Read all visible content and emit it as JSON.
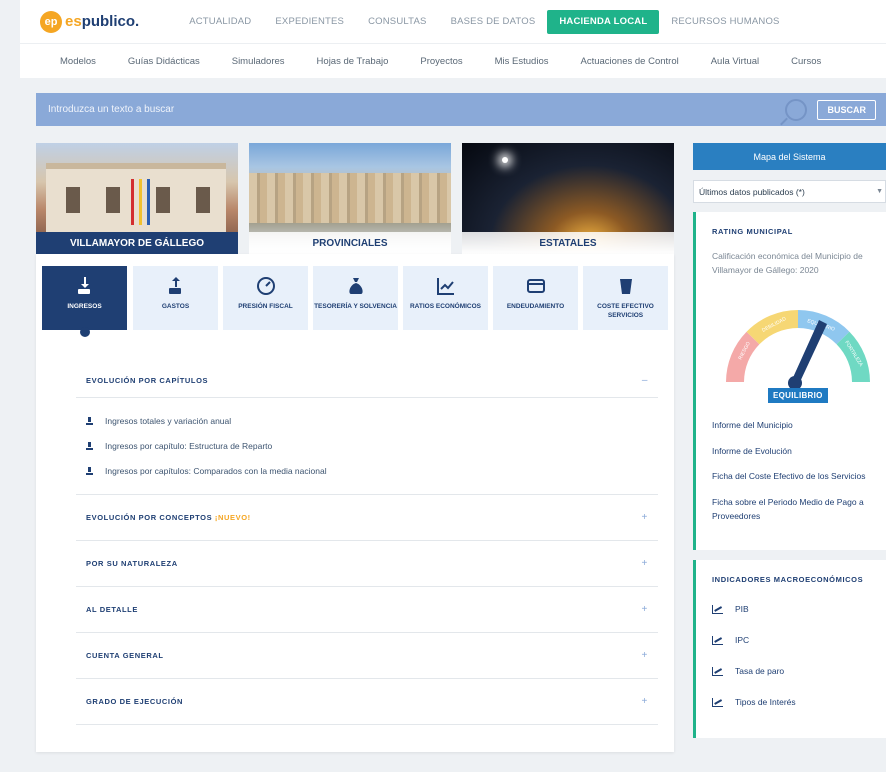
{
  "logo": {
    "mark": "ep",
    "part1": "es",
    "part2": "publico."
  },
  "main_nav": [
    "ACTUALIDAD",
    "EXPEDIENTES",
    "CONSULTAS",
    "BASES DE DATOS",
    "HACIENDA LOCAL",
    "RECURSOS HUMANOS"
  ],
  "main_nav_active": "HACIENDA LOCAL",
  "sub_nav": [
    "Modelos",
    "Guías Didácticas",
    "Simuladores",
    "Hojas de Trabajo",
    "Proyectos",
    "Mis Estudios",
    "Actuaciones de Control",
    "Aula Virtual",
    "Cursos"
  ],
  "search": {
    "placeholder": "Introduzca un texto a buscar",
    "button": "BUSCAR"
  },
  "cards": {
    "local": "VILLAMAYOR DE GÁLLEGO",
    "provincial": "PROVINCIALES",
    "state": "ESTATALES"
  },
  "tiles": [
    {
      "label": "INGRESOS",
      "icon": "download-hand-icon"
    },
    {
      "label": "GASTOS",
      "icon": "upload-hand-icon"
    },
    {
      "label": "PRESIÓN FISCAL",
      "icon": "gauge-icon"
    },
    {
      "label": "TESORERÍA Y SOLVENCIA",
      "icon": "money-bag-icon"
    },
    {
      "label": "RATIOS ECONÓMICOS",
      "icon": "line-chart-icon"
    },
    {
      "label": "ENDEUDAMIENTO",
      "icon": "credit-card-icon"
    },
    {
      "label": "COSTE EFECTIVO SERVICIOS",
      "icon": "trash-bin-icon"
    }
  ],
  "accordion": {
    "capitulos": {
      "title": "EVOLUCIÓN POR CAPÍTULOS",
      "toggle": "–"
    },
    "capitulos_links": [
      "Ingresos totales y variación anual",
      "Ingresos por capítulo: Estructura de Reparto",
      "Ingresos por capítulos: Comparados con la media nacional"
    ],
    "conceptos": {
      "title": "EVOLUCIÓN POR CONCEPTOS",
      "badge": "¡NUEVO!",
      "toggle": "+"
    },
    "naturaleza": {
      "title": "POR SU NATURALEZA",
      "toggle": "+"
    },
    "detalle": {
      "title": "AL DETALLE",
      "toggle": "+"
    },
    "cuenta": {
      "title": "CUENTA GENERAL",
      "toggle": "+"
    },
    "ejecucion": {
      "title": "GRADO DE EJECUCIÓN",
      "toggle": "+"
    }
  },
  "sidebar": {
    "sitemap_button": "Mapa del Sistema",
    "select_value": "Últimos datos publicados (*)",
    "rating": {
      "title": "RATING MUNICIPAL",
      "description": "Calificación económica del Municipio de Villamayor de Gállego: 2020",
      "gauge_segments": [
        "RIESGO",
        "DEBILIDAD",
        "EQUILIBRIO",
        "FORTALEZA"
      ],
      "gauge_colors": [
        "#f4a9a8",
        "#f6d774",
        "#8fc7ef",
        "#6fd9c3"
      ],
      "result": "EQUILIBRIO",
      "links": [
        "Informe del Municipio",
        "Informe de Evolución",
        "Ficha del Coste Efectivo de los Servicios",
        "Ficha sobre el Periodo Medio de Pago a Proveedores"
      ]
    },
    "macro": {
      "title": "INDICADORES MACROECONÓMICOS",
      "items": [
        "PIB",
        "IPC",
        "Tasa de paro",
        "Tipos de Interés"
      ]
    }
  },
  "colors": {
    "navy": "#1f3f73",
    "green": "#1fb38a",
    "blue": "#2a7fc1",
    "search": "#8aa9d8",
    "accent": "#f5a623"
  }
}
